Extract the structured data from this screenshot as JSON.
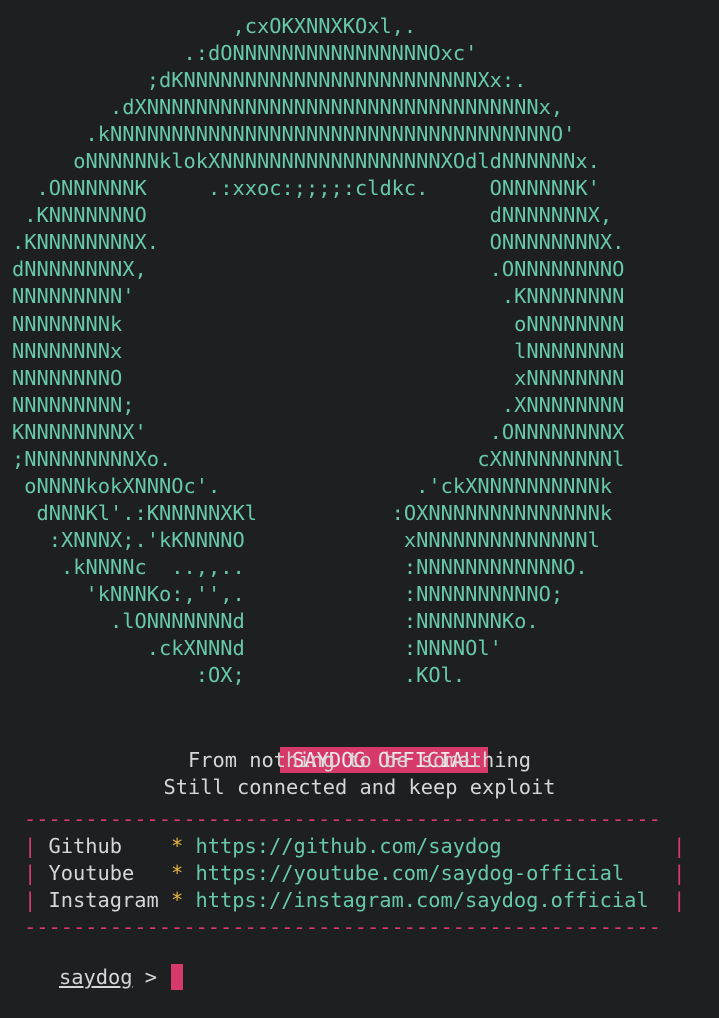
{
  "logo_ascii": [
    "                  ,cxOKXNNXKOxl,.",
    "              .:dONNNNNNNNNNNNNNNNOxc'",
    "           ;dKNNNNNNNNNNNNNNNNNNNNNNNNXx:.",
    "        .dXNNNNNNNNNNNNNNNNNNNNNNNNNNNNNNNNx,",
    "      .kNNNNNNNNNNNNNNNNNNNNNNNNNNNNNNNNNNNNO'",
    "     oNNNNNNklokXNNNNNNNNNNNNNNNNNNXOdldNNNNNNx.",
    "  .ONNNNNNK     .:xxoc:;;;;:cldkc.     ONNNNNNK'",
    " .KNNNNNNNO                            dNNNNNNNX,",
    ".KNNNNNNNNX.                           ONNNNNNNNX.",
    "dNNNNNNNNX,                            .ONNNNNNNNO",
    "NNNNNNNNN'                              .KNNNNNNNN",
    "NNNNNNNNk                                oNNNNNNNN",
    "NNNNNNNNx                                lNNNNNNNN",
    "NNNNNNNNO                                xNNNNNNNN",
    "NNNNNNNNN;                              .XNNNNNNNN",
    "KNNNNNNNNX'                            .ONNNNNNNNX",
    ";NNNNNNNNNXo.                         cXNNNNNNNNNl",
    " oNNNNkokXNNNOc'.                .'ckXNNNNNNNNNNk",
    "  dNNNKl'.:KNNNNNXKl           :OXNNNNNNNNNNNNNNk",
    "   :XNNNX;.'kKNNNNO             xNNNNNNNNNNNNNNl",
    "    .kNNNNc  ..,,..             :NNNNNNNNNNNNO.",
    "      'kNNNKo:,'',.             :NNNNNNNNNNO;",
    "        .lONNNNNNNd             :NNNNNNNKo.",
    "           .ckXNNNd             :NNNNOl'",
    "               :OX;             .KOl."
  ],
  "banner": {
    "title": "SAYDOG OFFICIAL",
    "tagline1": "From nothing to be something",
    "tagline2": "Still connected and keep exploit"
  },
  "info_box": {
    "border": "----------------------------------------------------",
    "pipe": "|",
    "star": "*",
    "rows": [
      {
        "label": "Github   ",
        "url": "https://github.com/saydog              "
      },
      {
        "label": "Youtube  ",
        "url": "https://youtube.com/saydog-official    "
      },
      {
        "label": "Instagram",
        "url": "https://instagram.com/saydog.official  "
      }
    ]
  },
  "prompt": {
    "user": "saydog",
    "symbol": ">"
  },
  "colors": {
    "background": "#1e1f21",
    "ascii_green": "#67c9a8",
    "accent_pink": "#d63a6b",
    "star_yellow": "#e5b53b"
  }
}
